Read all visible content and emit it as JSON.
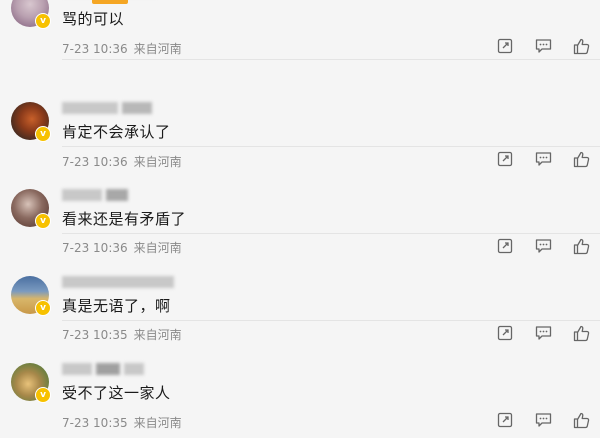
{
  "comments": [
    {
      "text": "骂的可以",
      "date": "7-23 10:36",
      "location": "来自河南",
      "avatar_colors": [
        "#d8c7cf",
        "#7e5b7a"
      ]
    },
    {
      "text": "肯定不会承认了",
      "date": "7-23 10:36",
      "location": "来自河南",
      "avatar_colors": [
        "#3a2a22",
        "#c8602a"
      ]
    },
    {
      "text": "看来还是有矛盾了",
      "date": "7-23 10:36",
      "location": "来自河南",
      "avatar_colors": [
        "#5a3a32",
        "#d7c2b8"
      ]
    },
    {
      "text": "真是无语了，啊",
      "date": "7-23 10:35",
      "location": "来自河南",
      "avatar_colors": [
        "#4a6fa0",
        "#d8b66a"
      ]
    },
    {
      "text": "受不了这一家人",
      "date": "7-23 10:35",
      "location": "来自河南",
      "avatar_colors": [
        "#4a7a3a",
        "#e8c27a"
      ]
    }
  ],
  "icons": {
    "share": "share-icon",
    "comment": "comment-icon",
    "like": "like-icon",
    "verified": "verified-badge-icon"
  },
  "colors": {
    "accent": "#f5a623",
    "verified": "#f7c100",
    "text": "#1a1a1a",
    "meta": "#8a8a8a"
  }
}
